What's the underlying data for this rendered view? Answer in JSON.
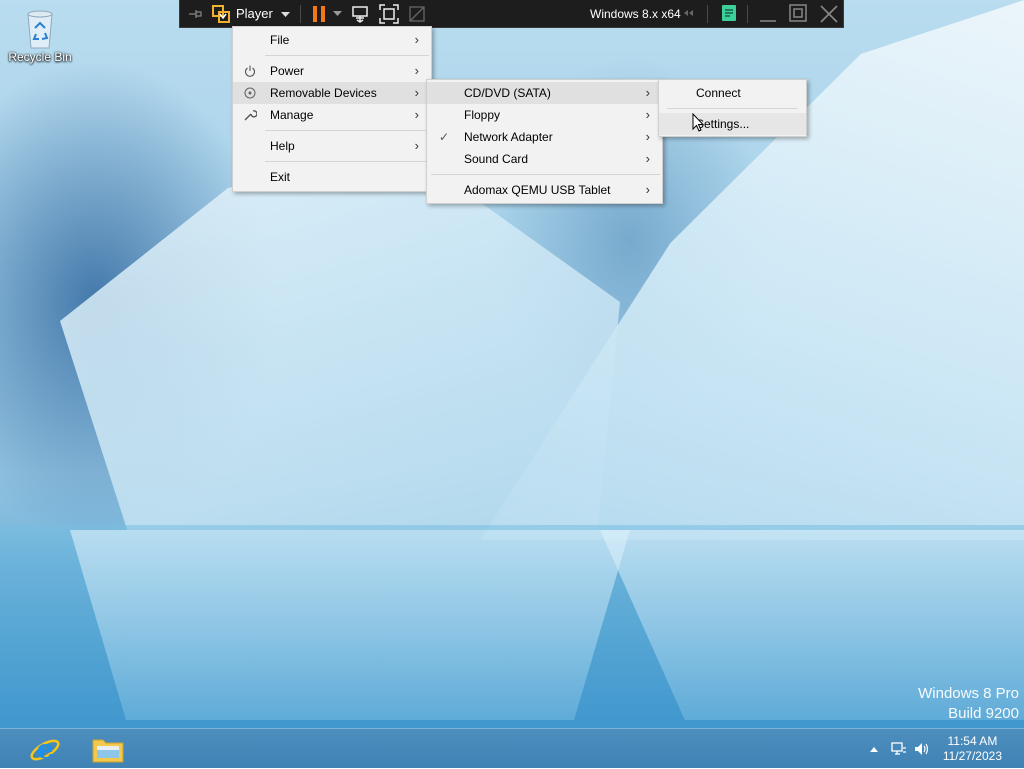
{
  "desktop": {
    "recycle_bin_label": "Recycle Bin",
    "watermark_line1": "Windows 8 Pro",
    "watermark_line2": "Build 9200"
  },
  "vm_toolbar": {
    "player_label": "Player",
    "vm_name": "Windows 8.x x64",
    "icons": [
      "pin-icon",
      "player-logo-icon",
      "chevron-down-icon",
      "pause-icon",
      "chevron-down-icon",
      "send-ctrl-alt-del-icon",
      "fullscreen-icon",
      "unity-icon",
      "notes-icon",
      "minimize-icon",
      "restore-icon",
      "close-icon"
    ],
    "pause_color": "#f07a1a"
  },
  "player_menu": {
    "items": [
      {
        "label": "File",
        "icon": "",
        "submenu": true
      },
      {
        "label": "Power",
        "icon": "power-icon",
        "submenu": true
      },
      {
        "label": "Removable Devices",
        "icon": "removable-devices-icon",
        "submenu": true
      },
      {
        "label": "Manage",
        "icon": "wrench-icon",
        "submenu": true
      },
      {
        "label": "Help",
        "icon": "",
        "submenu": true
      },
      {
        "label": "Exit",
        "icon": "",
        "submenu": false
      }
    ]
  },
  "devices_menu": {
    "items": [
      {
        "label": "CD/DVD (SATA)",
        "checked": false,
        "submenu": true
      },
      {
        "label": "Floppy",
        "checked": false,
        "submenu": true
      },
      {
        "label": "Network Adapter",
        "checked": true,
        "submenu": true
      },
      {
        "label": "Sound Card",
        "checked": false,
        "submenu": true
      },
      {
        "label": "Adomax QEMU USB Tablet",
        "checked": false,
        "submenu": true
      }
    ]
  },
  "cd_menu": {
    "items": [
      {
        "label": "Connect"
      },
      {
        "label": "Settings..."
      }
    ]
  },
  "taskbar": {
    "apps": [
      "internet-explorer-icon",
      "file-explorer-icon"
    ],
    "time": "11:54 AM",
    "date": "11/27/2023",
    "tray_icons": [
      "show-hidden-icons-icon",
      "network-icon",
      "volume-icon"
    ]
  }
}
